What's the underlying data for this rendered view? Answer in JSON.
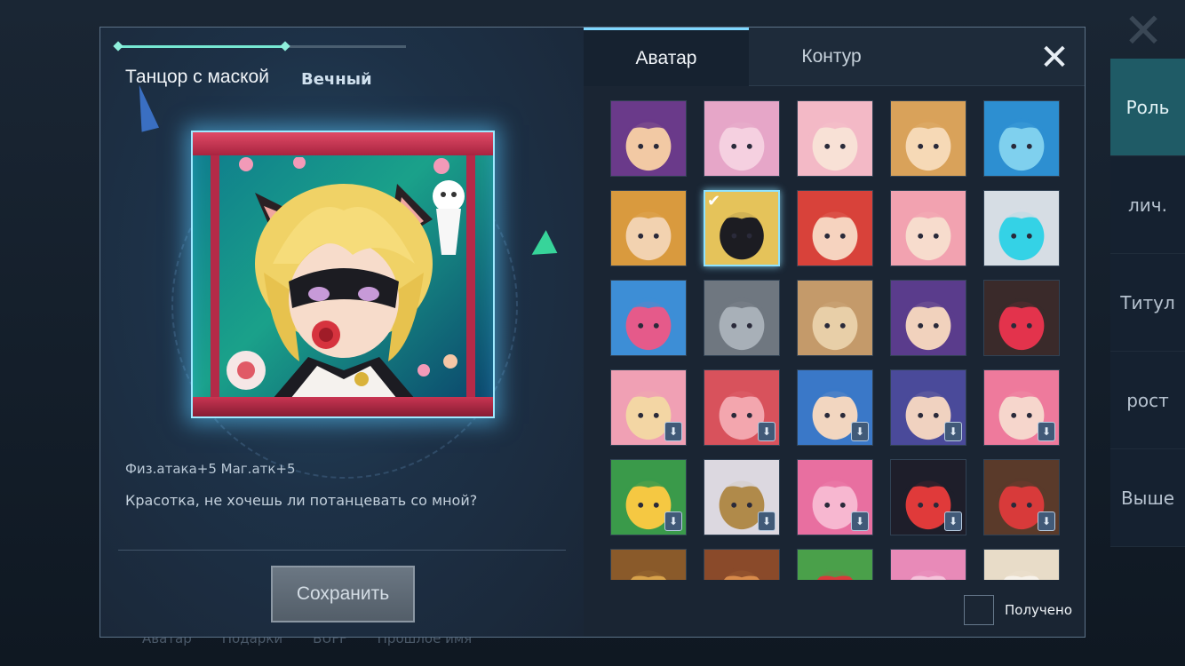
{
  "background": {
    "bottom_tabs": [
      "Аватар",
      "Подарки",
      "BUFF",
      "Прошлое имя"
    ],
    "side_tabs": [
      {
        "label": "Роль",
        "active": true
      },
      {
        "label": "лич.",
        "active": false
      },
      {
        "label": "Титул",
        "active": false
      },
      {
        "label": "рост",
        "active": false
      },
      {
        "label": "Выше",
        "active": false
      }
    ]
  },
  "left": {
    "skin_name": "Танцор с маской",
    "rarity": "Вечный",
    "stats": "Физ.атака+5  Маг.атк+5",
    "quote": "Красотка, не хочешь ли потанцевать со мной?",
    "save_label": "Сохранить"
  },
  "tabs": [
    {
      "label": "Аватар",
      "active": true
    },
    {
      "label": "Контур",
      "active": false
    }
  ],
  "close_icon": "close-icon",
  "avatars": [
    {
      "name": "purple-hair-girl",
      "color": "#6a3a8a",
      "accent": "#f2c9a4",
      "locked": false,
      "selected": false
    },
    {
      "name": "pink-dragon",
      "color": "#e6a6c8",
      "accent": "#f5d0e0",
      "locked": false,
      "selected": false
    },
    {
      "name": "pink-hair-girl",
      "color": "#f3b9c6",
      "accent": "#f8e1d6",
      "locked": false,
      "selected": false
    },
    {
      "name": "blonde-girl",
      "color": "#d9a25a",
      "accent": "#f6d9b6",
      "locked": false,
      "selected": false
    },
    {
      "name": "blue-hood-girl",
      "color": "#2d8fd1",
      "accent": "#7fd0ee",
      "locked": false,
      "selected": false
    },
    {
      "name": "duck-hat-boy",
      "color": "#d99a3e",
      "accent": "#f2d2b0",
      "locked": false,
      "selected": false
    },
    {
      "name": "masked-dancer",
      "color": "#e5c35a",
      "accent": "#1c1c22",
      "locked": false,
      "selected": true
    },
    {
      "name": "red-hair-boy",
      "color": "#d8423a",
      "accent": "#f6d3bf",
      "locked": false,
      "selected": false
    },
    {
      "name": "pink-hair-bun-girl",
      "color": "#f2a2b0",
      "accent": "#f7dccd",
      "locked": false,
      "selected": false
    },
    {
      "name": "white-hair-cyber",
      "color": "#d6dde4",
      "accent": "#34d2e6",
      "locked": false,
      "selected": false
    },
    {
      "name": "blue-hair-visor-girl",
      "color": "#3d8ed6",
      "accent": "#e55a8a",
      "locked": false,
      "selected": false
    },
    {
      "name": "grey-wolf",
      "color": "#6f7780",
      "accent": "#a8b0b8",
      "locked": false,
      "selected": false
    },
    {
      "name": "tan-bear",
      "color": "#c49a6a",
      "accent": "#e8cfa8",
      "locked": false,
      "selected": false
    },
    {
      "name": "purple-hair-boy",
      "color": "#5a3c8c",
      "accent": "#f1d2bd",
      "locked": false,
      "selected": false
    },
    {
      "name": "dark-hair-flower-girl",
      "color": "#3a2a2a",
      "accent": "#e3334c",
      "locked": false,
      "selected": false
    },
    {
      "name": "cat-donut",
      "color": "#f0a0b4",
      "accent": "#f3d6a4",
      "locked": true,
      "selected": false
    },
    {
      "name": "taiyaki-fish",
      "color": "#d8525c",
      "accent": "#f3a6ae",
      "locked": true,
      "selected": false
    },
    {
      "name": "blue-cat-boy",
      "color": "#3a78c8",
      "accent": "#f2d6c0",
      "locked": true,
      "selected": false
    },
    {
      "name": "indigo-hair-boy",
      "color": "#4a4a9a",
      "accent": "#f0d2c0",
      "locked": true,
      "selected": false
    },
    {
      "name": "pink-hair-sleep-girl",
      "color": "#ee7a9c",
      "accent": "#f6d6cc",
      "locked": true,
      "selected": false
    },
    {
      "name": "christmas-tree",
      "color": "#3a9a4a",
      "accent": "#f5c842",
      "locked": true,
      "selected": false
    },
    {
      "name": "white-wolf-boy",
      "color": "#dcd8e0",
      "accent": "#b08a4a",
      "locked": true,
      "selected": false
    },
    {
      "name": "pink-dino",
      "color": "#e86fa0",
      "accent": "#f7b7d0",
      "locked": true,
      "selected": false
    },
    {
      "name": "crane-hair-girl",
      "color": "#1e1e2a",
      "accent": "#e03a3a",
      "locked": true,
      "selected": false
    },
    {
      "name": "brown-hair-bow-girl",
      "color": "#5a3a2a",
      "accent": "#d83a3a",
      "locked": true,
      "selected": false
    },
    {
      "name": "wolf-hat-1",
      "color": "#8a5a2a",
      "accent": "#d8a24a",
      "locked": false,
      "selected": false
    },
    {
      "name": "wolf-hat-2",
      "color": "#8a4a2a",
      "accent": "#d88a4a",
      "locked": false,
      "selected": false
    },
    {
      "name": "green-dino-bow",
      "color": "#4aa04a",
      "accent": "#d83a3a",
      "locked": false,
      "selected": false
    },
    {
      "name": "pink-blob",
      "color": "#e88ab8",
      "accent": "#f5c2da",
      "locked": false,
      "selected": false
    },
    {
      "name": "cream-cloud",
      "color": "#e8dcc8",
      "accent": "#f7f2ea",
      "locked": false,
      "selected": false
    }
  ],
  "obtained_label": "Получено"
}
